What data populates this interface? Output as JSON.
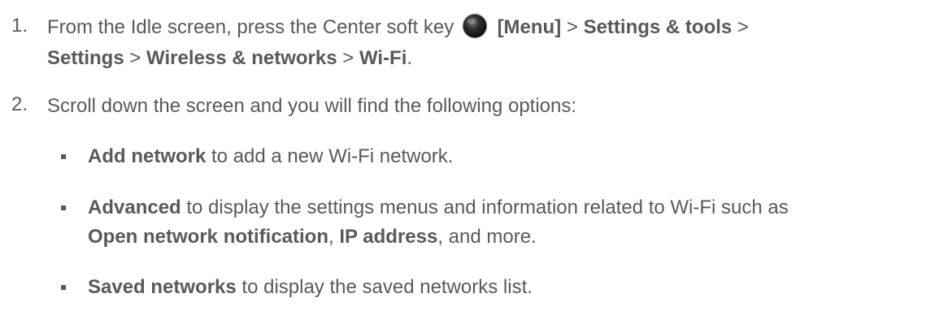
{
  "steps": [
    {
      "number": "1.",
      "parts": [
        "From the Idle screen, press the Center soft key",
        "[Menu]",
        " > ",
        "Settings & tools",
        " >",
        "Settings",
        " > ",
        "Wireless & networks",
        " > ",
        "Wi-Fi",
        "."
      ],
      "icon": "center-soft-key-icon"
    },
    {
      "number": "2.",
      "text": "Scroll down the screen and you will find the following options:"
    }
  ],
  "options": [
    {
      "term": "Add network",
      "desc": " to add a new Wi-Fi network."
    },
    {
      "term": "Advanced",
      "desc": " to display the settings menus and information related to Wi-Fi such as",
      "term2": "Open network notification",
      "sep": ", ",
      "term3": "IP address",
      "desc2": ", and more."
    },
    {
      "term": "Saved networks",
      "desc": " to display the saved networks list."
    }
  ],
  "colors": {
    "text": "#595959",
    "key_dark": "#1a1a1a"
  }
}
